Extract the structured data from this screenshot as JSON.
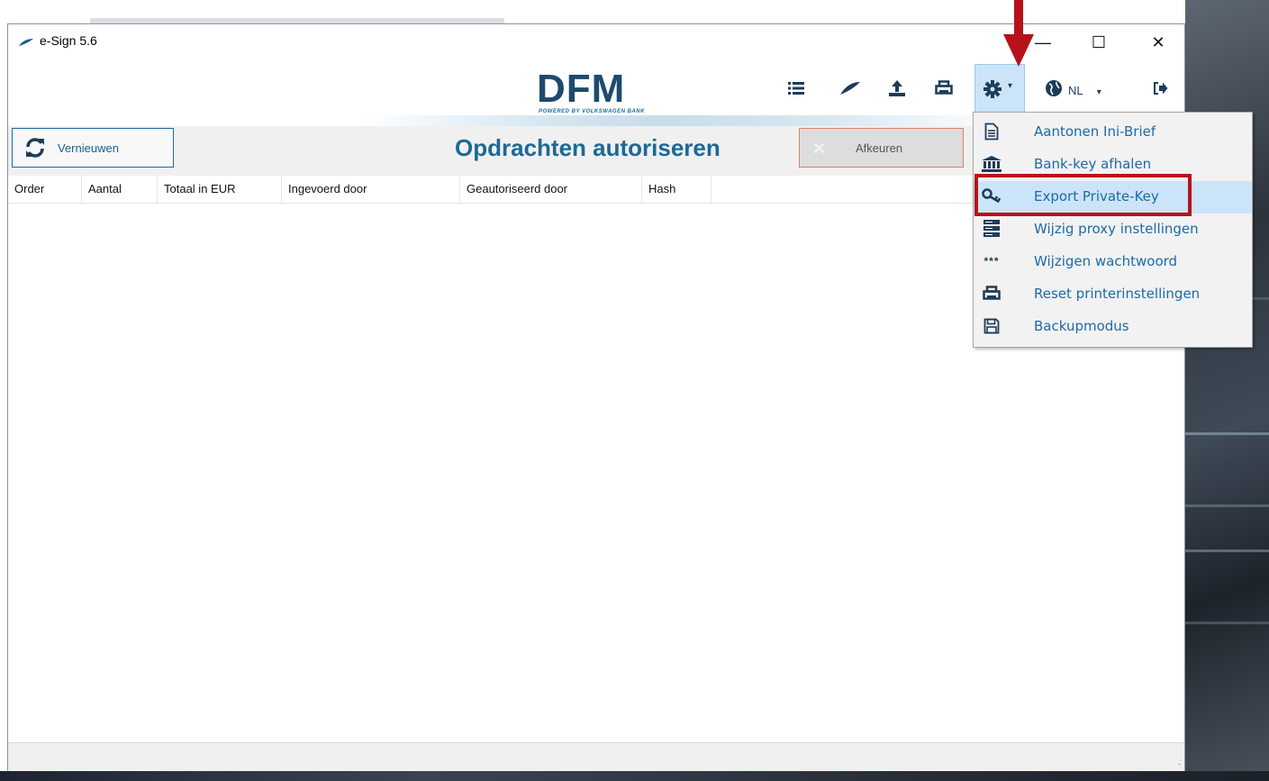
{
  "window": {
    "title": "e-Sign 5.6",
    "minimize_glyph": "—",
    "maximize_glyph": "☐",
    "close_glyph": "✕"
  },
  "logo": {
    "main": "DFM",
    "sub": "POWERED BY VOLKSWAGEN BANK"
  },
  "toolbar": {
    "icons": [
      "list-icon",
      "feather-icon",
      "upload-icon",
      "printer-icon",
      "gear-icon",
      "globe-icon",
      "logout-icon"
    ],
    "language": "NL"
  },
  "actions": {
    "refresh_label": "Vernieuwen",
    "page_title": "Opdrachten autoriseren",
    "reject_label": "Afkeuren"
  },
  "table": {
    "columns": [
      "Order",
      "Aantal",
      "Totaal in EUR",
      "Ingevoerd door",
      "Geautoriseerd door",
      "Hash"
    ]
  },
  "menu": {
    "items": [
      {
        "label": "Aantonen Ini-Brief",
        "icon": "document-icon"
      },
      {
        "label": "Bank-key afhalen",
        "icon": "bank-icon"
      },
      {
        "label": "Export Private-Key",
        "icon": "key-icon"
      },
      {
        "label": "Wijzig proxy instellingen",
        "icon": "server-icon"
      },
      {
        "label": "Wijzigen wachtwoord",
        "icon": "password-icon"
      },
      {
        "label": "Reset printerinstellingen",
        "icon": "printer-icon"
      },
      {
        "label": "Backupmodus",
        "icon": "save-icon"
      }
    ],
    "password_glyph": "***"
  },
  "colors": {
    "accent": "#1c6996",
    "highlight": "#b5121b",
    "menu_text": "#1c6aa8"
  }
}
